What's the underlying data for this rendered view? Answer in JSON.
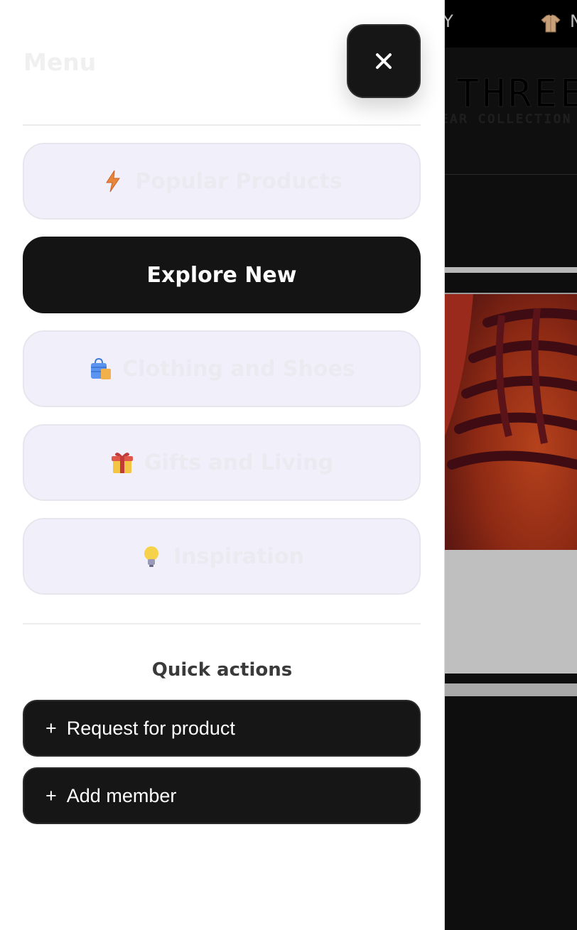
{
  "background_page": {
    "topbar_text_left": "LY",
    "topbar_text_right": "N",
    "shirt_icon": "shirt-icon",
    "brand": "THREE",
    "brand_sub": "EAR COLLECTION"
  },
  "drawer": {
    "title": "Menu",
    "close_icon": "close-icon",
    "nav_items": [
      {
        "label": "Popular Products",
        "icon": "lightning-icon",
        "active": false
      },
      {
        "label": "Explore New",
        "icon": "",
        "active": true
      },
      {
        "label": "Clothing and Shoes",
        "icon": "shopping-bag-icon",
        "active": false
      },
      {
        "label": "Gifts and Living",
        "icon": "gift-icon",
        "active": false
      },
      {
        "label": "Inspiration",
        "icon": "light-bulb-icon",
        "active": false
      }
    ],
    "quick_actions": {
      "title": "Quick actions",
      "items": [
        {
          "plus": "+",
          "label": "Request for product"
        },
        {
          "plus": "+",
          "label": "Add member"
        }
      ]
    }
  },
  "colors": {
    "active_bg": "#141414",
    "nav_bg": "#f1f0fa",
    "nav_text_faded": "#eaeaf0"
  }
}
